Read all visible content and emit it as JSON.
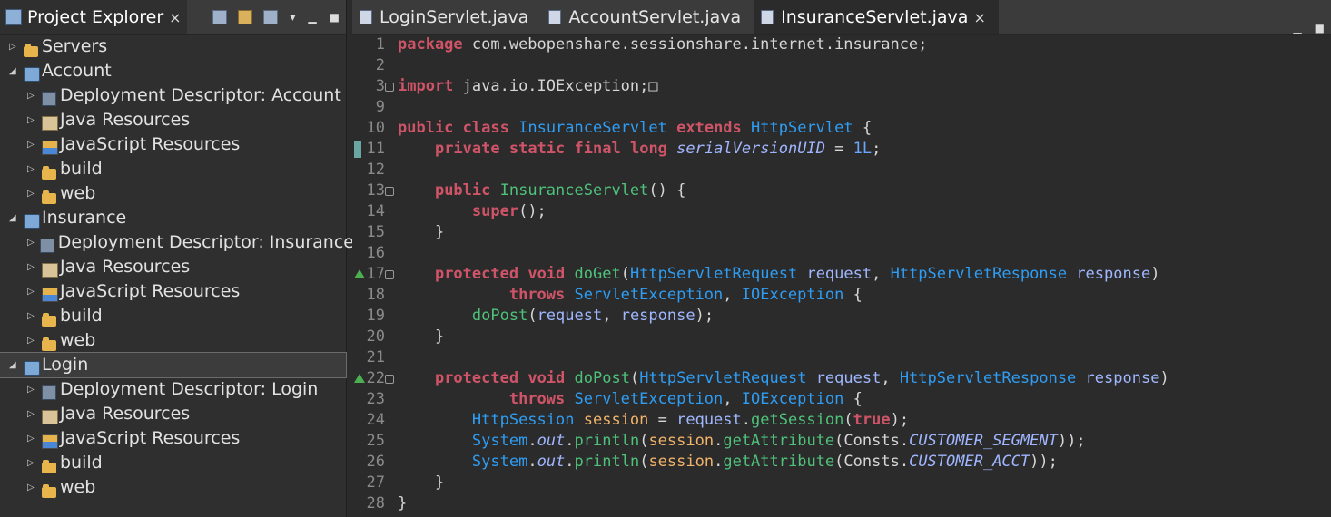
{
  "explorer": {
    "title": "Project Explorer",
    "tree": [
      {
        "label": "Servers",
        "level": 0,
        "icon": "folder-icon",
        "expanded": false
      },
      {
        "label": "Account",
        "level": 0,
        "icon": "project-icon",
        "expanded": true
      },
      {
        "label": "Deployment Descriptor: Account",
        "level": 1,
        "icon": "deployment-descriptor-icon"
      },
      {
        "label": "Java Resources",
        "level": 1,
        "icon": "java-resources-icon"
      },
      {
        "label": "JavaScript Resources",
        "level": 1,
        "icon": "javascript-resources-icon"
      },
      {
        "label": "build",
        "level": 1,
        "icon": "folder-icon"
      },
      {
        "label": "web",
        "level": 1,
        "icon": "folder-icon"
      },
      {
        "label": "Insurance",
        "level": 0,
        "icon": "project-icon",
        "expanded": true
      },
      {
        "label": "Deployment Descriptor: Insurance",
        "level": 1,
        "icon": "deployment-descriptor-icon"
      },
      {
        "label": "Java Resources",
        "level": 1,
        "icon": "java-resources-icon"
      },
      {
        "label": "JavaScript Resources",
        "level": 1,
        "icon": "javascript-resources-icon"
      },
      {
        "label": "build",
        "level": 1,
        "icon": "folder-icon"
      },
      {
        "label": "web",
        "level": 1,
        "icon": "folder-icon"
      },
      {
        "label": "Login",
        "level": 0,
        "icon": "project-icon",
        "expanded": true,
        "selected": true
      },
      {
        "label": "Deployment Descriptor: Login",
        "level": 1,
        "icon": "deployment-descriptor-icon"
      },
      {
        "label": "Java Resources",
        "level": 1,
        "icon": "java-resources-icon"
      },
      {
        "label": "JavaScript Resources",
        "level": 1,
        "icon": "javascript-resources-icon"
      },
      {
        "label": "build",
        "level": 1,
        "icon": "folder-icon"
      },
      {
        "label": "web",
        "level": 1,
        "icon": "folder-icon"
      }
    ]
  },
  "editor": {
    "tabs": [
      {
        "label": "LoginServlet.java",
        "active": false
      },
      {
        "label": "AccountServlet.java",
        "active": false
      },
      {
        "label": "InsuranceServlet.java",
        "active": true
      }
    ],
    "lines": [
      {
        "n": "1",
        "tokens": [
          [
            "kw",
            "package"
          ],
          [
            "",
            " com.webopenshare.sessionshare.internet.insurance;"
          ]
        ]
      },
      {
        "n": "2",
        "tokens": []
      },
      {
        "n": "3",
        "fold": true,
        "tokens": [
          [
            "kw",
            "import"
          ],
          [
            "",
            " java.io.IOException;"
          ],
          [
            "",
            "□"
          ]
        ]
      },
      {
        "n": "9",
        "tokens": []
      },
      {
        "n": "10",
        "tokens": [
          [
            "kw",
            "public"
          ],
          [
            "",
            " "
          ],
          [
            "kw",
            "class"
          ],
          [
            "",
            " "
          ],
          [
            "type",
            "InsuranceServlet"
          ],
          [
            "",
            " "
          ],
          [
            "kw",
            "extends"
          ],
          [
            "",
            " "
          ],
          [
            "type",
            "HttpServlet"
          ],
          [
            "",
            " {"
          ]
        ]
      },
      {
        "n": "11",
        "mark": "change",
        "tokens": [
          [
            "",
            "    "
          ],
          [
            "kw",
            "private"
          ],
          [
            "",
            " "
          ],
          [
            "kw",
            "static"
          ],
          [
            "",
            " "
          ],
          [
            "kw",
            "final"
          ],
          [
            "",
            " "
          ],
          [
            "kw",
            "long"
          ],
          [
            "",
            " "
          ],
          [
            "field",
            "serialVersionUID"
          ],
          [
            "",
            " = "
          ],
          [
            "num",
            "1L"
          ],
          [
            "",
            ";"
          ]
        ]
      },
      {
        "n": "12",
        "tokens": []
      },
      {
        "n": "13",
        "fold": true,
        "tokens": [
          [
            "",
            "    "
          ],
          [
            "kw",
            "public"
          ],
          [
            "",
            " "
          ],
          [
            "method",
            "InsuranceServlet"
          ],
          [
            "",
            "() {"
          ]
        ]
      },
      {
        "n": "14",
        "tokens": [
          [
            "",
            "        "
          ],
          [
            "kw",
            "super"
          ],
          [
            "",
            "();"
          ]
        ]
      },
      {
        "n": "15",
        "tokens": [
          [
            "",
            "    }"
          ]
        ]
      },
      {
        "n": "16",
        "tokens": []
      },
      {
        "n": "17",
        "mark": "override",
        "fold": true,
        "tokens": [
          [
            "",
            "    "
          ],
          [
            "kw",
            "protected"
          ],
          [
            "",
            " "
          ],
          [
            "kw",
            "void"
          ],
          [
            "",
            " "
          ],
          [
            "method",
            "doGet"
          ],
          [
            "",
            "("
          ],
          [
            "type",
            "HttpServletRequest"
          ],
          [
            "",
            " "
          ],
          [
            "param",
            "request"
          ],
          [
            "",
            ", "
          ],
          [
            "type",
            "HttpServletResponse"
          ],
          [
            "",
            " "
          ],
          [
            "param",
            "response"
          ],
          [
            "",
            ")"
          ]
        ]
      },
      {
        "n": "18",
        "tokens": [
          [
            "",
            "            "
          ],
          [
            "kw",
            "throws"
          ],
          [
            "",
            " "
          ],
          [
            "type",
            "ServletException"
          ],
          [
            "",
            ", "
          ],
          [
            "type",
            "IOException"
          ],
          [
            "",
            " {"
          ]
        ]
      },
      {
        "n": "19",
        "tokens": [
          [
            "",
            "        "
          ],
          [
            "method",
            "doPost"
          ],
          [
            "",
            "("
          ],
          [
            "param",
            "request"
          ],
          [
            "",
            ", "
          ],
          [
            "param",
            "response"
          ],
          [
            "",
            ");"
          ]
        ]
      },
      {
        "n": "20",
        "tokens": [
          [
            "",
            "    }"
          ]
        ]
      },
      {
        "n": "21",
        "tokens": []
      },
      {
        "n": "22",
        "mark": "override",
        "fold": true,
        "tokens": [
          [
            "",
            "    "
          ],
          [
            "kw",
            "protected"
          ],
          [
            "",
            " "
          ],
          [
            "kw",
            "void"
          ],
          [
            "",
            " "
          ],
          [
            "method",
            "doPost"
          ],
          [
            "",
            "("
          ],
          [
            "type",
            "HttpServletRequest"
          ],
          [
            "",
            " "
          ],
          [
            "param",
            "request"
          ],
          [
            "",
            ", "
          ],
          [
            "type",
            "HttpServletResponse"
          ],
          [
            "",
            " "
          ],
          [
            "param",
            "response"
          ],
          [
            "",
            ")"
          ]
        ]
      },
      {
        "n": "23",
        "tokens": [
          [
            "",
            "            "
          ],
          [
            "kw",
            "throws"
          ],
          [
            "",
            " "
          ],
          [
            "type",
            "ServletException"
          ],
          [
            "",
            ", "
          ],
          [
            "type",
            "IOException"
          ],
          [
            "",
            " {"
          ]
        ]
      },
      {
        "n": "24",
        "tokens": [
          [
            "",
            "        "
          ],
          [
            "type",
            "HttpSession"
          ],
          [
            "",
            " "
          ],
          [
            "var",
            "session"
          ],
          [
            "",
            " = "
          ],
          [
            "param",
            "request"
          ],
          [
            "",
            "."
          ],
          [
            "method",
            "getSession"
          ],
          [
            "",
            "("
          ],
          [
            "kw",
            "true"
          ],
          [
            "",
            ");"
          ]
        ]
      },
      {
        "n": "25",
        "tokens": [
          [
            "",
            "        "
          ],
          [
            "type",
            "System"
          ],
          [
            "",
            "."
          ],
          [
            "field",
            "out"
          ],
          [
            "",
            "."
          ],
          [
            "method",
            "println"
          ],
          [
            "",
            "("
          ],
          [
            "var",
            "session"
          ],
          [
            "",
            "."
          ],
          [
            "method",
            "getAttribute"
          ],
          [
            "",
            "("
          ],
          [
            "",
            "Consts."
          ],
          [
            "field",
            "CUSTOMER_SEGMENT"
          ],
          [
            "",
            "));"
          ]
        ]
      },
      {
        "n": "26",
        "tokens": [
          [
            "",
            "        "
          ],
          [
            "type",
            "System"
          ],
          [
            "",
            "."
          ],
          [
            "field",
            "out"
          ],
          [
            "",
            "."
          ],
          [
            "method",
            "println"
          ],
          [
            "",
            "("
          ],
          [
            "var",
            "session"
          ],
          [
            "",
            "."
          ],
          [
            "method",
            "getAttribute"
          ],
          [
            "",
            "("
          ],
          [
            "",
            "Consts."
          ],
          [
            "field",
            "CUSTOMER_ACCT"
          ],
          [
            "",
            "));"
          ]
        ]
      },
      {
        "n": "27",
        "tokens": [
          [
            "",
            "    }"
          ]
        ]
      },
      {
        "n": "28",
        "tokens": [
          [
            "",
            "}"
          ]
        ]
      }
    ]
  }
}
